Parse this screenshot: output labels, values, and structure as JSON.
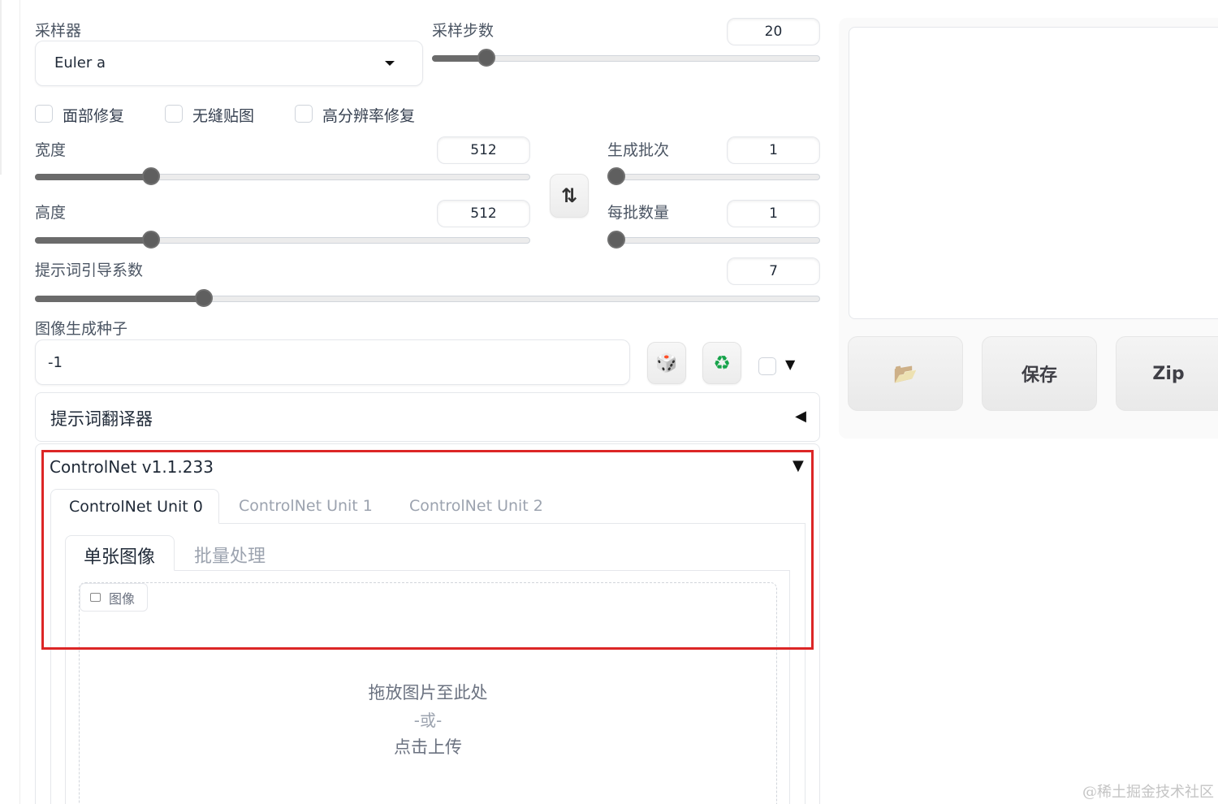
{
  "sampler": {
    "label": "采样器",
    "value": "Euler a"
  },
  "steps": {
    "label": "采样步数",
    "value": "20",
    "fraction": 0.14
  },
  "options": {
    "face_restore": "面部修复",
    "tiling": "无缝贴图",
    "hires_fix": "高分辨率修复"
  },
  "width": {
    "label": "宽度",
    "value": "512",
    "fraction": 0.235
  },
  "height": {
    "label": "高度",
    "value": "512",
    "fraction": 0.235
  },
  "swap_icon": "⇅",
  "batch_count": {
    "label": "生成批次",
    "value": "1",
    "fraction": 0.0
  },
  "batch_size": {
    "label": "每批数量",
    "value": "1",
    "fraction": 0.0
  },
  "cfg_scale": {
    "label": "提示词引导系数",
    "value": "7",
    "fraction": 0.215
  },
  "seed": {
    "label": "图像生成种子",
    "value": "-1",
    "dice_icon": "🎲",
    "recycle_icon": "♻",
    "extra_arrow": "▼"
  },
  "translator": {
    "title": "提示词翻译器",
    "arrow": "◀"
  },
  "controlnet": {
    "title": "ControlNet v1.1.233",
    "arrow": "▼",
    "units": [
      "ControlNet Unit 0",
      "ControlNet Unit 1",
      "ControlNet Unit 2"
    ],
    "subtabs": [
      "单张图像",
      "批量处理"
    ],
    "image_label": "图像",
    "drop_text": "拖放图片至此处",
    "or_text": "-或-",
    "upload_text": "点击上传"
  },
  "output": {
    "folder_icon": "📂",
    "save_label": "保存",
    "zip_label": "Zip"
  },
  "watermark": "@稀土掘金技术社区",
  "colors": {
    "highlight": "#dc2626",
    "slider_fill": "#6b6b6b"
  }
}
